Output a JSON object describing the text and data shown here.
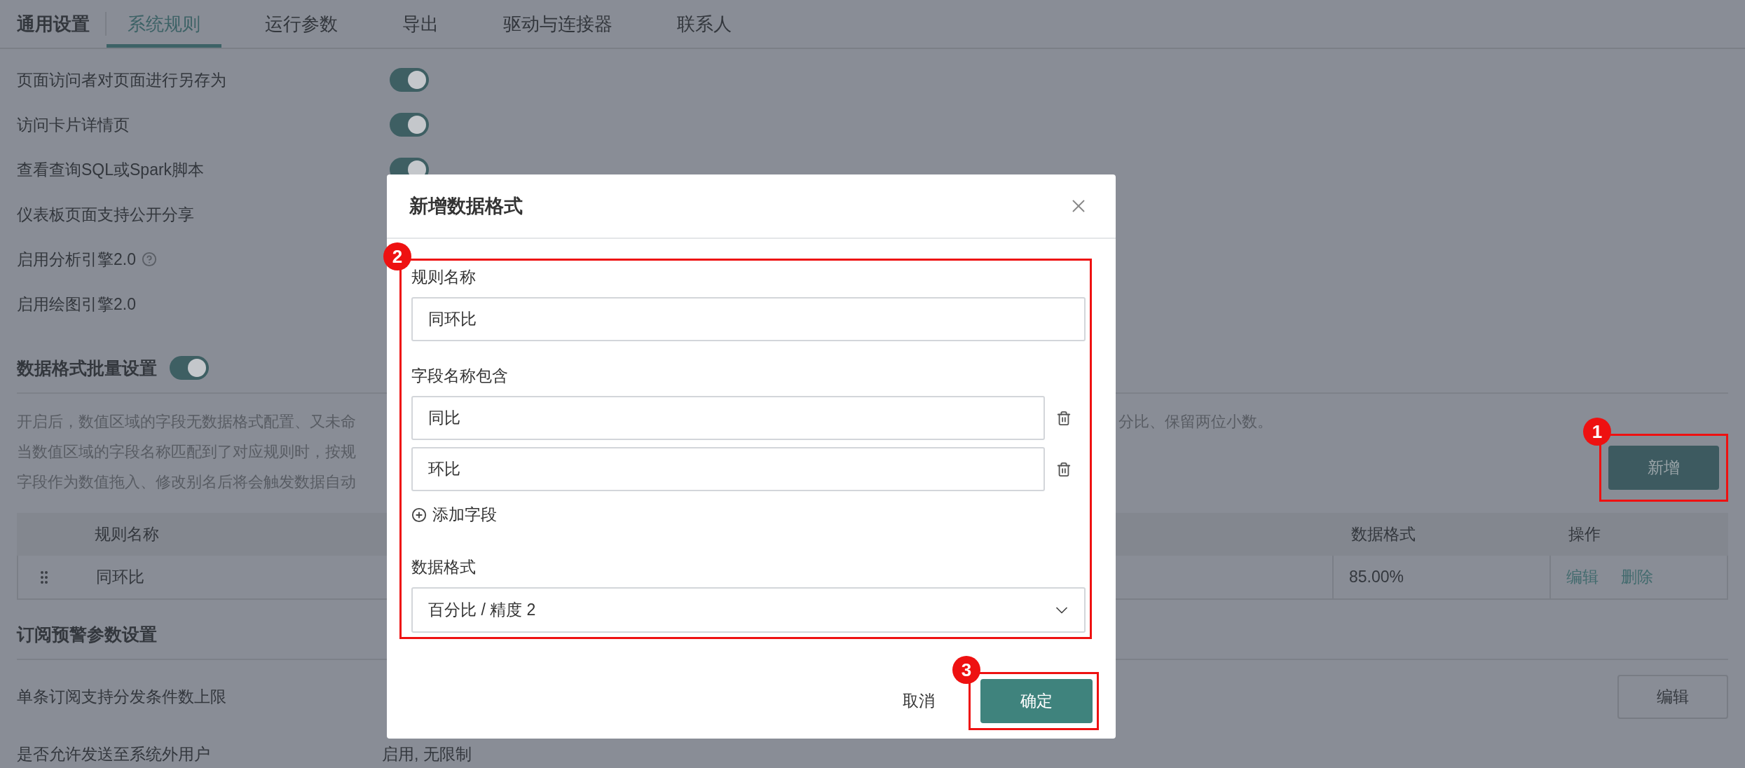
{
  "page_title": "通用设置",
  "tabs": [
    {
      "label": "系统规则",
      "selected": true
    },
    {
      "label": "运行参数",
      "selected": false
    },
    {
      "label": "导出",
      "selected": false
    },
    {
      "label": "驱动与连接器",
      "selected": false
    },
    {
      "label": "联系人",
      "selected": false
    }
  ],
  "rules": [
    {
      "label": "页面访问者对页面进行另存为",
      "kind": "toggle",
      "on": true
    },
    {
      "label": "访问卡片详情页",
      "kind": "toggle",
      "on": true
    },
    {
      "label": "查看查询SQL或Spark脚本",
      "kind": "toggle",
      "on": true
    },
    {
      "label": "仪表板页面支持公开分享",
      "kind": "plain"
    },
    {
      "label": "启用分析引擎2.0",
      "kind": "help"
    },
    {
      "label": "启用绘图引擎2.0",
      "kind": "plain"
    }
  ],
  "format_section": {
    "title": "数据格式批量设置",
    "on": true,
    "description_left": [
      "开启后，数值区域的字段无数据格式配置、又未命",
      "当数值区域的字段名称匹配到了对应规则时，按规",
      "字段作为数值拖入、修改别名后将会触发数据自动"
    ],
    "description_right": "分比、保留两位小数。",
    "add_button": "新增",
    "table": {
      "columns": [
        "规则名称",
        "数据格式",
        "操作"
      ],
      "rows": [
        {
          "name": "同环比",
          "format": "85.00%",
          "actions": [
            "编辑",
            "删除"
          ]
        }
      ]
    }
  },
  "subscription_section": {
    "title": "订阅预警参数设置",
    "rows": [
      {
        "label": "单条订阅支持分发条件数上限",
        "button": "编辑"
      },
      {
        "label": "是否允许发送至系统外用户",
        "value": "启用, 无限制"
      }
    ]
  },
  "modal": {
    "title": "新增数据格式",
    "rule_name_label": "规则名称",
    "rule_name_value": "同环比",
    "fields_label": "字段名称包含",
    "fields": [
      "同比",
      "环比"
    ],
    "add_field": "添加字段",
    "format_label": "数据格式",
    "format_value": "百分比 / 精度 2",
    "cancel": "取消",
    "confirm": "确定"
  },
  "annotations": [
    {
      "label": "1"
    },
    {
      "label": "2"
    },
    {
      "label": "3"
    }
  ]
}
